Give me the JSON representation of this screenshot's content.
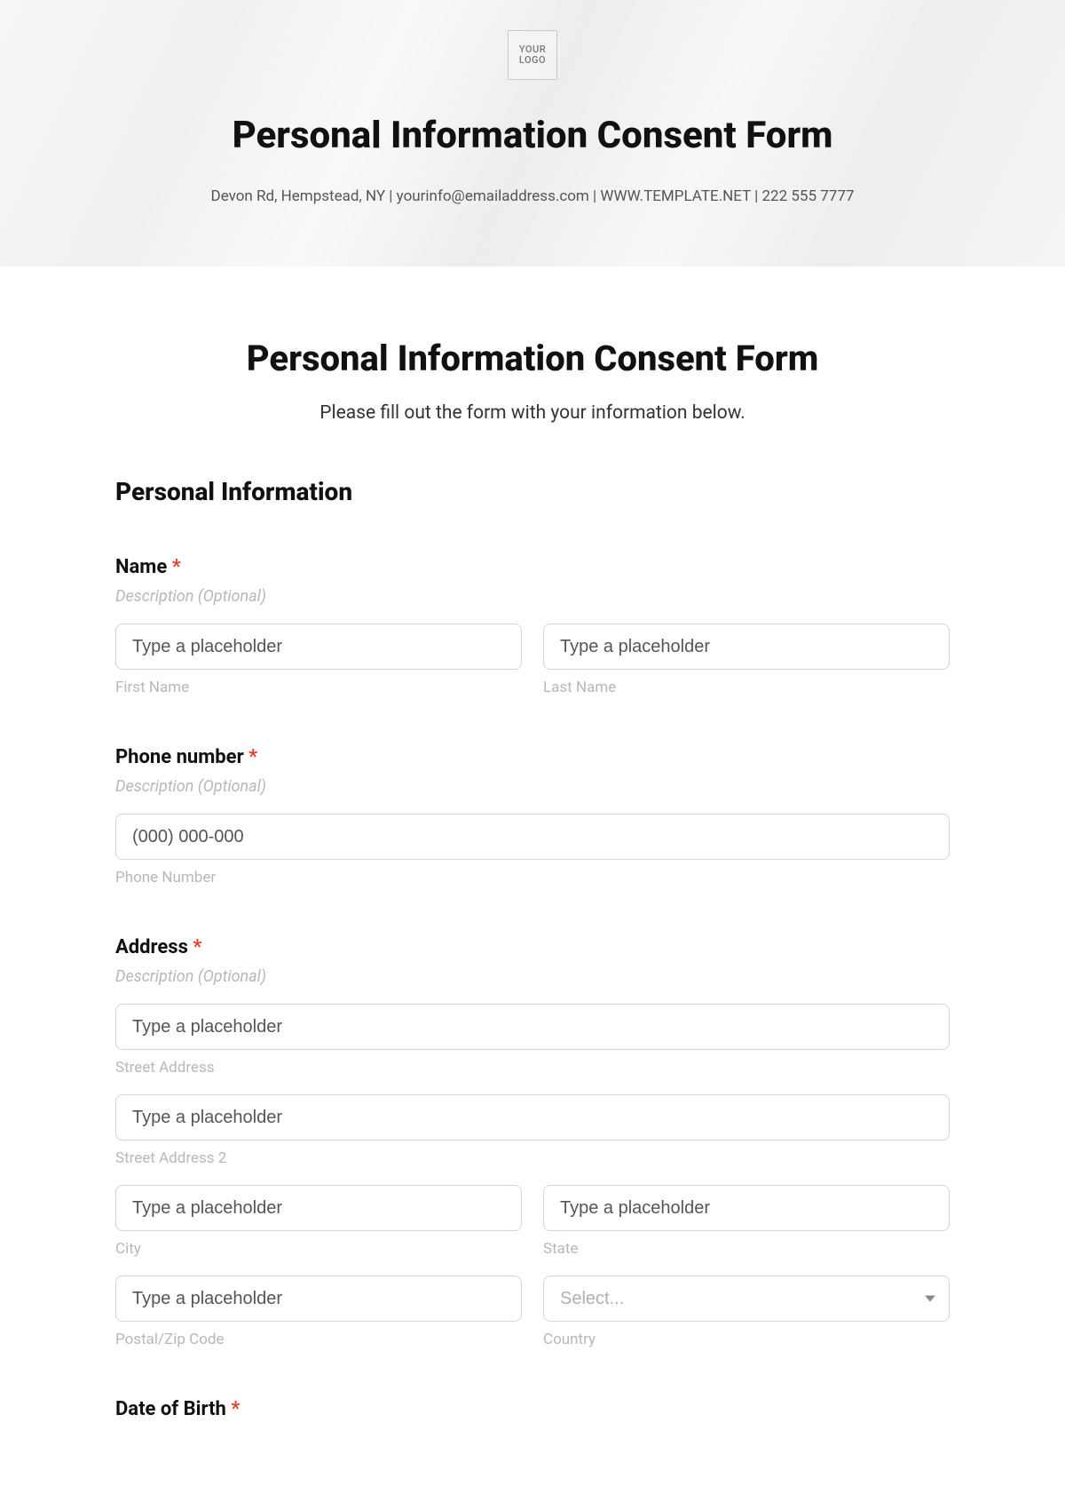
{
  "header": {
    "logo_text": "YOUR\nLOGO",
    "title": "Personal Information Consent Form",
    "contact_line": "Devon Rd, Hempstead, NY | yourinfo@emailaddress.com | WWW.TEMPLATE.NET | 222 555 7777"
  },
  "body": {
    "title": "Personal Information Consent Form",
    "subtitle": "Please fill out the form with your information below.",
    "section_personal": "Personal Information",
    "common": {
      "required_mark": "*",
      "desc_optional": "Description (Optional)",
      "placeholder_generic": "Type a placeholder",
      "select_placeholder": "Select..."
    },
    "fields": {
      "name": {
        "label": "Name",
        "first_sub": "First Name",
        "last_sub": "Last Name"
      },
      "phone": {
        "label": "Phone number",
        "placeholder": "(000) 000-000",
        "sub": "Phone Number"
      },
      "address": {
        "label": "Address",
        "street_sub": "Street Address",
        "street2_sub": "Street Address 2",
        "city_sub": "City",
        "state_sub": "State",
        "postal_sub": "Postal/Zip Code",
        "country_sub": "Country"
      },
      "dob": {
        "label": "Date of Birth"
      }
    }
  }
}
